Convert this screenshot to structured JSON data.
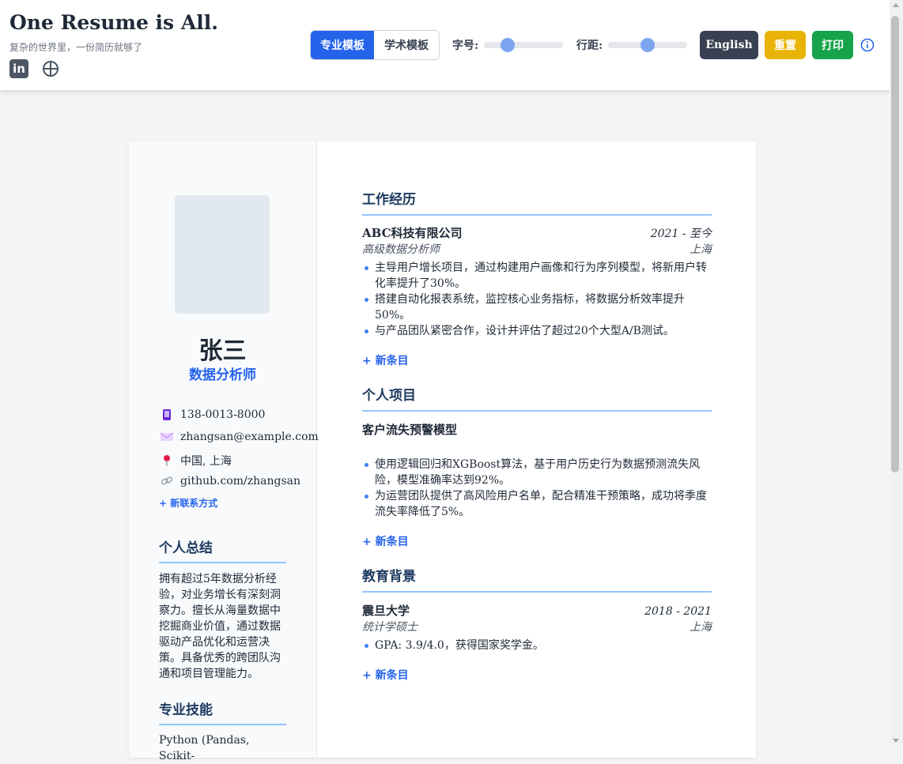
{
  "header": {
    "title": "One Resume is All.",
    "subtitle": "复杂的世界里，一份简历就够了",
    "social": [
      {
        "icon": "linkedin-icon",
        "glyph": "in"
      },
      {
        "icon": "globe-icon"
      }
    ],
    "templates": {
      "professional": "专业模板",
      "academic": "学术模板",
      "active": "professional"
    },
    "font_size": {
      "label": "字号:",
      "value_fraction": 0.3
    },
    "line_height": {
      "label": "行距:",
      "value_fraction": 0.5
    },
    "language_button": "English",
    "reset_button": "重置",
    "print_button": "打印",
    "info_icon": "info-icon"
  },
  "colors": {
    "accent": "#2563eb",
    "dark_button": "#374151",
    "reset": "#eab308",
    "print": "#16a34a",
    "heading": "#1e3a5f",
    "rule": "#93c5fd"
  },
  "profile": {
    "name": "张三",
    "title": "数据分析师",
    "contacts": [
      {
        "icon": "phone-icon",
        "text": "138-0013-8000"
      },
      {
        "icon": "email-icon",
        "text": "zhangsan@example.com"
      },
      {
        "icon": "location-pin-icon",
        "text": "中国, 上海"
      },
      {
        "icon": "link-icon",
        "text": "github.com/zhangsan"
      }
    ],
    "add_contact": "+ 新联系方式"
  },
  "summary": {
    "heading": "个人总结",
    "lines": [
      "拥有超过5年数据分析经",
      "验，对业务增长有深刻洞",
      "察力。擅长从海量数据中",
      "挖掘商业价值，通过数据",
      "驱动产品优化和运营决",
      "策。具备优秀的跨团队沟",
      "通和项目管理能力。"
    ]
  },
  "skills": {
    "heading": "专业技能",
    "first_line": "Python (Pandas, Scikit-"
  },
  "work": {
    "heading": "工作经历",
    "company": "ABC科技有限公司",
    "dates": "2021 - 至今",
    "role": "高级数据分析师",
    "location": "上海",
    "bullets": [
      [
        "主导用户增长项目，通过构建用户画像和行为序列模型，将新用户转",
        "化率提升了30%。"
      ],
      [
        "搭建自动化报表系统，监控核心业务指标，将数据分析效率提升",
        "50%。"
      ],
      [
        "与产品团队紧密合作，设计并评估了超过20个大型A/B测试。"
      ]
    ],
    "add_entry": "+ 新条目"
  },
  "projects": {
    "heading": "个人项目",
    "name": "客户流失预警模型",
    "bullets": [
      [
        "使用逻辑回归和XGBoost算法，基于用户历史行为数据预测流失风",
        "险，模型准确率达到92%。"
      ],
      [
        "为运营团队提供了高风险用户名单，配合精准干预策略，成功将季度",
        "流失率降低了5%。"
      ]
    ],
    "add_entry": "+ 新条目"
  },
  "education": {
    "heading": "教育背景",
    "school": "震旦大学",
    "dates": "2018 - 2021",
    "degree": "统计学硕士",
    "location": "上海",
    "bullets": [
      [
        "GPA: 3.9/4.0，获得国家奖学金。"
      ]
    ],
    "add_entry": "+ 新条目"
  }
}
